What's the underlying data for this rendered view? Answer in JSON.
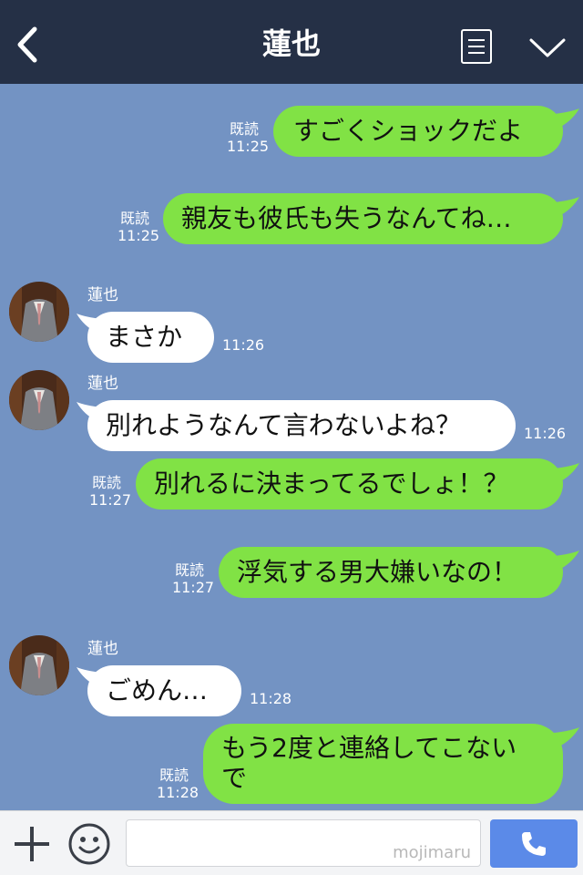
{
  "header": {
    "contact_name": "蓮也"
  },
  "contact": {
    "name": "蓮也"
  },
  "messages": {
    "m1": {
      "text": "すごくショックだよ",
      "read": "既読",
      "time": "11:25"
    },
    "m2": {
      "text": "親友も彼氏も失うなんてね…",
      "read": "既読",
      "time": "11:25"
    },
    "m3": {
      "text": "まさか",
      "time": "11:26"
    },
    "m4": {
      "text": "別れようなんて言わないよね？",
      "time": "11:26"
    },
    "m5": {
      "text": "別れるに決まってるでしょ！？",
      "read": "既読",
      "time": "11:27"
    },
    "m6": {
      "text": "浮気する男大嫌いなの！",
      "read": "既読",
      "time": "11:27"
    },
    "m7": {
      "text": "ごめん…",
      "time": "11:28"
    },
    "m8": {
      "line1": "もう2度と連絡してこない",
      "line2": "で",
      "read": "既読",
      "time": "11:28"
    }
  },
  "footer": {
    "input_value": "",
    "watermark": "mojimaru"
  },
  "icons": {
    "back": "back-chevron-icon",
    "menu": "note-menu-icon",
    "expand": "chevron-down-icon",
    "plus": "plus-icon",
    "emoji": "smiley-icon",
    "call": "phone-icon"
  },
  "colors": {
    "header": "#253046",
    "chat_background": "#7393c3",
    "outgoing_bubble": "#81e245",
    "incoming_bubble": "#ffffff",
    "call_button": "#5b8ae8"
  }
}
